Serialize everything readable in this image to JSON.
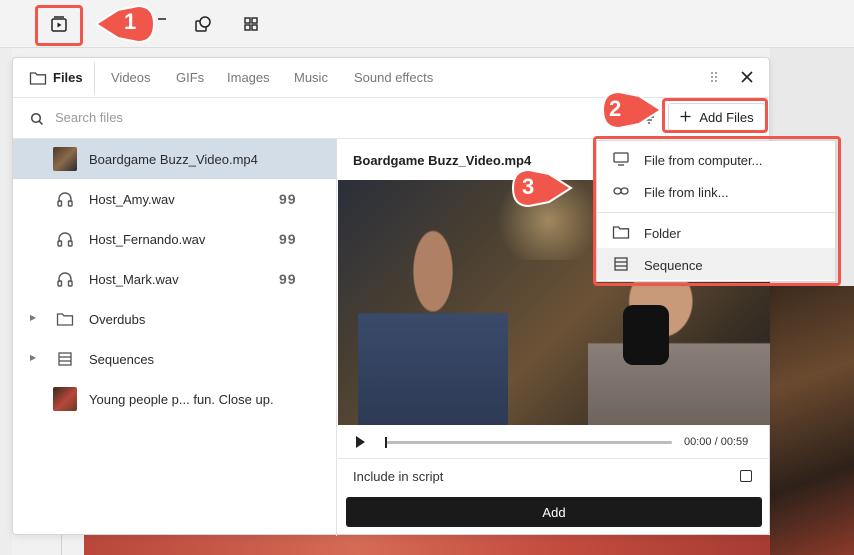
{
  "tabs": [
    {
      "label": "Files",
      "active": true
    },
    {
      "label": "Videos"
    },
    {
      "label": "GIFs"
    },
    {
      "label": "Images"
    },
    {
      "label": "Music"
    },
    {
      "label": "Sound effects"
    }
  ],
  "search": {
    "placeholder": "Search files"
  },
  "add_files_label": "Add Files",
  "files": [
    {
      "label": "Boardgame Buzz_Video.mp4",
      "icon": "video-thumbnail",
      "selected": true
    },
    {
      "label": "Host_Amy.wav",
      "icon": "headphones-icon",
      "badge": "99"
    },
    {
      "label": "Host_Fernando.wav",
      "icon": "headphones-icon",
      "badge": "99"
    },
    {
      "label": "Host_Mark.wav",
      "icon": "headphones-icon",
      "badge": "99"
    },
    {
      "label": "Overdubs",
      "icon": "folder-icon",
      "expandable": true
    },
    {
      "label": "Sequences",
      "icon": "sequence-icon",
      "expandable": true
    },
    {
      "label": "Young people p... fun. Close up.",
      "icon": "image-thumbnail"
    }
  ],
  "preview": {
    "title": "Boardgame Buzz_Video.mp4",
    "time": "00:00 / 00:59",
    "progress": 0.0,
    "include_label": "Include in script",
    "add_label": "Add"
  },
  "menu": {
    "items": [
      {
        "label": "File from computer...",
        "icon": "monitor-icon"
      },
      {
        "label": "File from link...",
        "icon": "link-icon"
      },
      {
        "label": "Folder",
        "icon": "folder-icon"
      },
      {
        "label": "Sequence",
        "icon": "sequence-icon",
        "hover": true
      }
    ]
  },
  "callouts": [
    "1",
    "2",
    "3"
  ],
  "colors": {
    "highlight": "#f0574a",
    "selected_row": "#d3dde8",
    "button_dark": "#1a1a1a"
  }
}
